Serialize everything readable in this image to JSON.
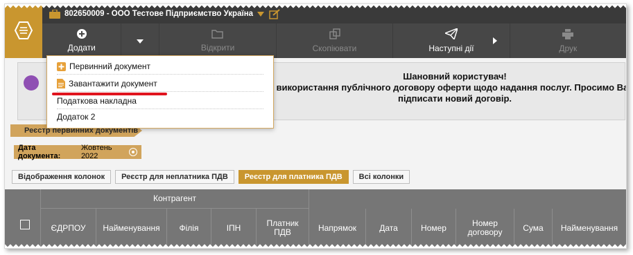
{
  "app": {
    "company": "802650009 - ООО Тестове Підприємство Україна"
  },
  "toolbar": {
    "add_label": "Додати",
    "open_label": "Відкрити",
    "copy_label": "Скопіювати",
    "next_label": "Наступні дії",
    "print_label": "Друк"
  },
  "dropdown": {
    "items": [
      {
        "label": "Первинний документ",
        "icon": "plus-icon"
      },
      {
        "label": "Завантажити документ",
        "icon": "document-icon"
      },
      {
        "label": "Податкова накладна"
      },
      {
        "label": "Додаток 2"
      }
    ]
  },
  "notice": {
    "title": "Шановний користувач!",
    "line1": "використання публічного договору оферти щодо надання послуг. Просимо Вас",
    "line2": "підписати новий договір."
  },
  "breadcrumb": {
    "label": "Реєстр первинних документів"
  },
  "filter": {
    "label": "Дата документа:",
    "value": "Жовтень 2022"
  },
  "tabs": [
    {
      "label": "Відображення колонок",
      "active": false
    },
    {
      "label": "Реєстр для неплатника ПДВ",
      "active": false
    },
    {
      "label": "Реєстр для платника ПДВ",
      "active": true
    },
    {
      "label": "Всі колонки",
      "active": false
    }
  ],
  "table": {
    "group_header": "Контрагент",
    "columns": [
      "ЄДРПОУ",
      "Найменування",
      "Філія",
      "ІПН",
      "Платник ПДВ",
      "Напрямок",
      "Дата",
      "Номер",
      "Номер договору",
      "Сума",
      "Найменування"
    ]
  },
  "colors": {
    "accent": "#c9962f",
    "header_bg": "#767676",
    "topbar_bg": "#3a3a3a",
    "underline": "#e0141e"
  }
}
